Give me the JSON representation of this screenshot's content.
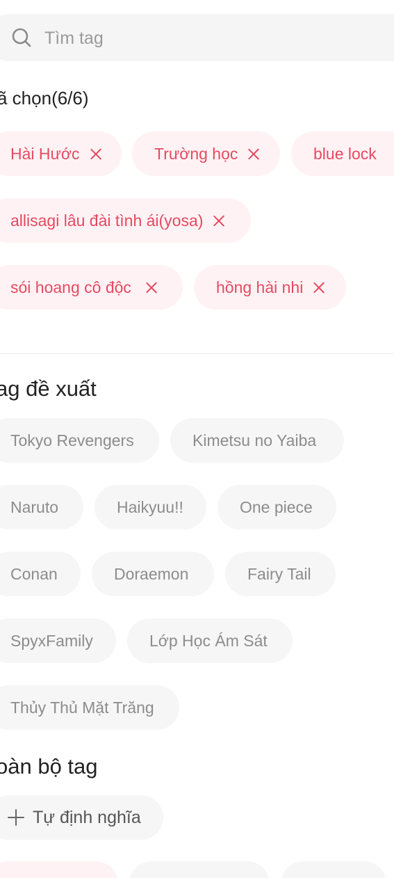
{
  "search": {
    "placeholder": "Tìm tag",
    "icon": "search-icon"
  },
  "selected": {
    "title": "ã chọn(6/6)",
    "tags": [
      {
        "label": "Hài Hước"
      },
      {
        "label": "Trường học"
      },
      {
        "label": "blue lock"
      },
      {
        "label": "allisagi lâu đài tình ái(yosa)"
      },
      {
        "label": "sói hoang cô độc"
      },
      {
        "label": "hồng hài nhi"
      }
    ],
    "accent_color": "#e44a62",
    "chip_bg": "#fff2f4"
  },
  "suggested": {
    "title": "ag đề xuất",
    "tags": [
      {
        "label": "Tokyo Revengers"
      },
      {
        "label": "Kimetsu no Yaiba"
      },
      {
        "label": "Naruto"
      },
      {
        "label": "Haikyuu!!"
      },
      {
        "label": "One piece"
      },
      {
        "label": "Conan"
      },
      {
        "label": "Doraemon"
      },
      {
        "label": "Fairy Tail"
      },
      {
        "label": "SpyxFamily"
      },
      {
        "label": "Lớp Học Ám Sát"
      },
      {
        "label": "Thủy Thủ Mặt Trăng"
      }
    ]
  },
  "all_tags": {
    "title": "oàn bộ tag",
    "custom_label": "Tự định nghĩa"
  }
}
